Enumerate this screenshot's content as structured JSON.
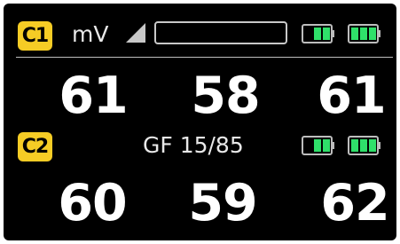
{
  "colors": {
    "background": "#000000",
    "badge": "#f6cc25",
    "battery_fill": "#2fe06a",
    "battery_outline": "#bdbdbd",
    "text": "#ffffff"
  },
  "channel1": {
    "badge": "C1",
    "unit": "mV",
    "signal_icon": "signal-strength-icon",
    "level_bar_fill": 0,
    "battery_a_level": 0.6,
    "battery_b_level": 1.0,
    "values": [
      "61",
      "58",
      "61"
    ]
  },
  "channel2": {
    "badge": "C2",
    "info": "GF 15/85",
    "battery_a_level": 0.6,
    "battery_b_level": 1.0,
    "values": [
      "60",
      "59",
      "62"
    ]
  }
}
